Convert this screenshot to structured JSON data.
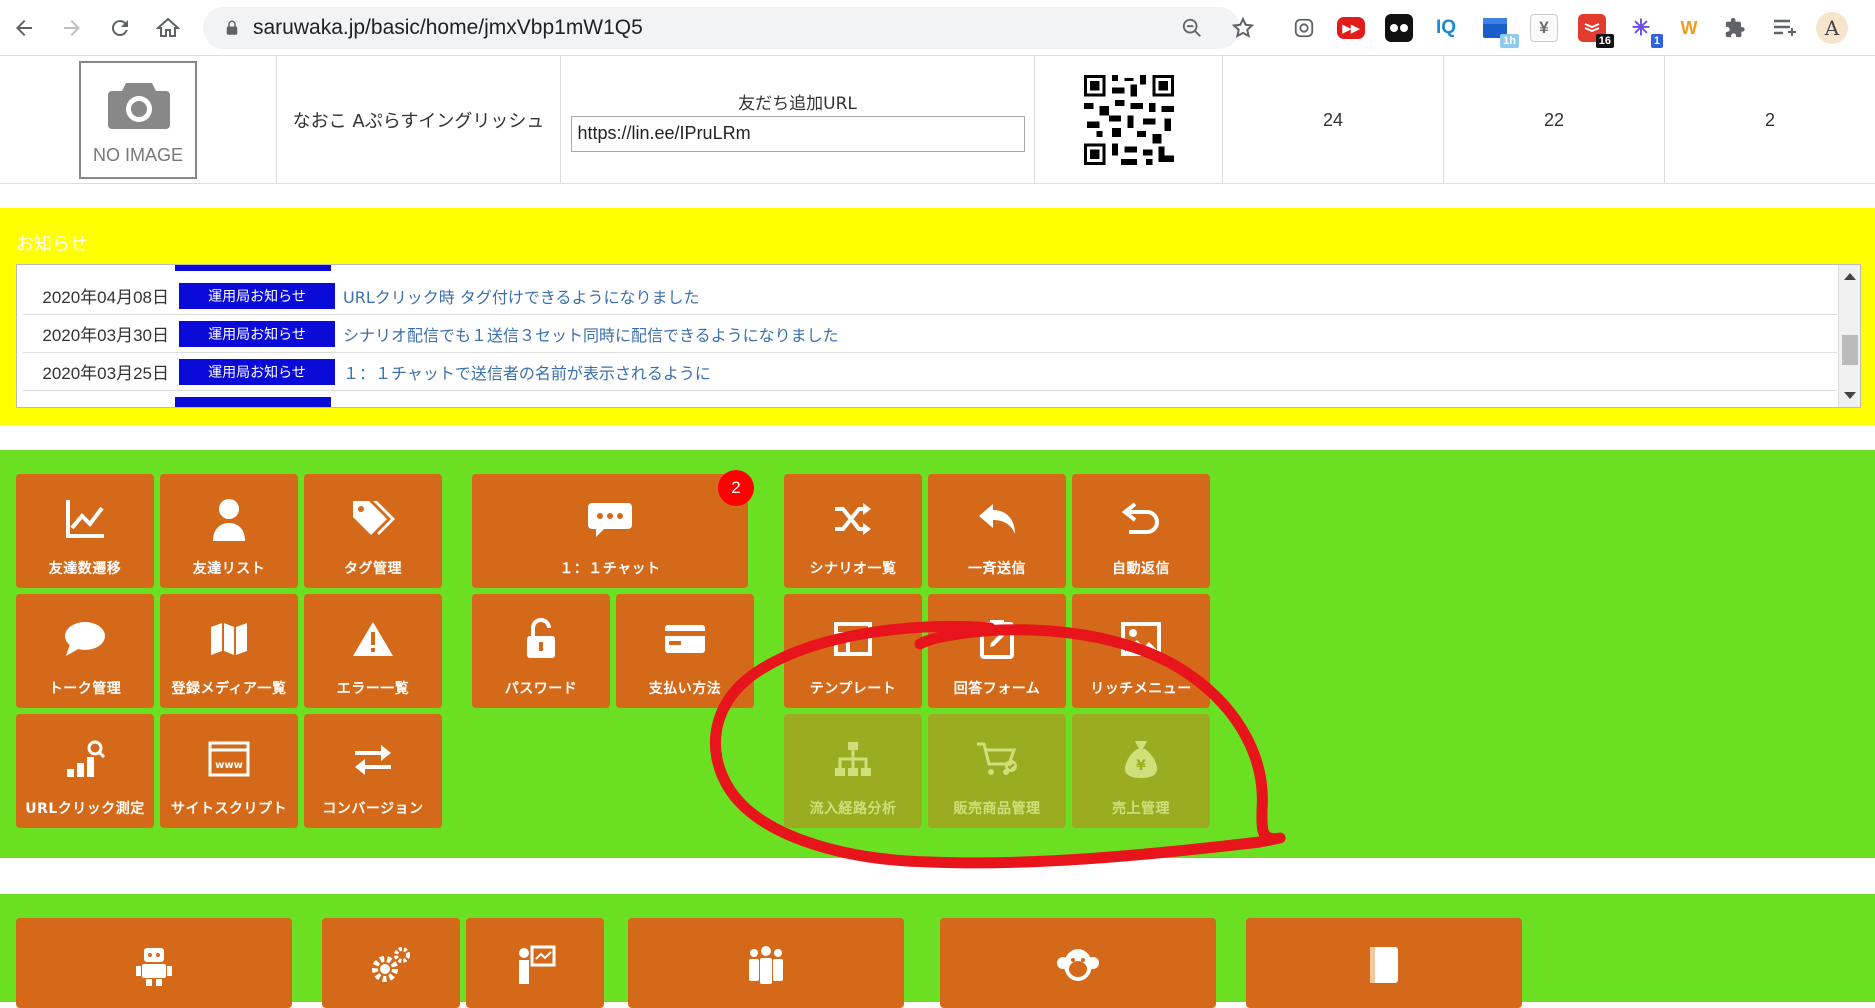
{
  "browser": {
    "url": "saruwaka.jp/basic/home/jmxVbp1mW1Q5",
    "extensions": [
      {
        "name": "screen-capture-icon",
        "label": ""
      },
      {
        "name": "youtube-icon",
        "label": "▶▶"
      },
      {
        "name": "glasses-icon",
        "label": ""
      },
      {
        "name": "iq-icon",
        "label": "IQ"
      },
      {
        "name": "calendar-icon",
        "label": "",
        "badge": "1h"
      },
      {
        "name": "yen-icon",
        "label": "¥"
      },
      {
        "name": "todoist-icon",
        "label": "",
        "badge": "16"
      },
      {
        "name": "spark-icon",
        "label": "✳",
        "badge": "1"
      },
      {
        "name": "w-icon",
        "label": "W"
      },
      {
        "name": "puzzle-icon",
        "label": ""
      },
      {
        "name": "reading-list-icon",
        "label": ""
      },
      {
        "name": "profile-icon",
        "label": "A"
      }
    ]
  },
  "friend_info": {
    "no_image_text": "NO IMAGE",
    "account_name": "なおこ Aぷらすイングリッシュ",
    "url_label": "友だち追加URL",
    "url_value": "https://lin.ee/IPruLRm",
    "counts": [
      "24",
      "22",
      "2"
    ]
  },
  "notice": {
    "title": "お知らせ",
    "items": [
      {
        "date": "2020年04月08日",
        "badge": "運用局お知らせ",
        "text": "URLクリック時 タグ付けできるようになりました"
      },
      {
        "date": "2020年03月30日",
        "badge": "運用局お知らせ",
        "text": "シナリオ配信でも１送信３セット同時に配信できるようになりました"
      },
      {
        "date": "2020年03月25日",
        "badge": "運用局お知らせ",
        "text": "１：１チャットで送信者の名前が表示されるように"
      }
    ]
  },
  "menu": {
    "friend_growth": "友達数遷移",
    "friend_list": "友達リスト",
    "tag_manage": "タグ管理",
    "chat": "１：１チャット",
    "chat_badge": "2",
    "scenario_list": "シナリオ一覧",
    "broadcast": "一斉送信",
    "auto_reply": "自動返信",
    "talk_manage": "トーク管理",
    "media_list": "登録メディア一覧",
    "error_list": "エラー一覧",
    "password": "パスワード",
    "payment": "支払い方法",
    "template": "テンプレート",
    "answer_form": "回答フォーム",
    "rich_menu": "リッチメニュー",
    "url_click": "URLクリック測定",
    "site_script": "サイトスクリプト",
    "conversion": "コンバージョン",
    "inflow_analysis": "流入経路分析",
    "product_manage": "販売商品管理",
    "sales_manage": "売上管理"
  },
  "colors": {
    "tile": "#d4691a",
    "tile_muted": "#9bab22",
    "section_green": "#6be022",
    "notice_yellow": "#ffff00",
    "badge_blue": "#0a0ad9",
    "annotation_red": "#e8141b"
  }
}
